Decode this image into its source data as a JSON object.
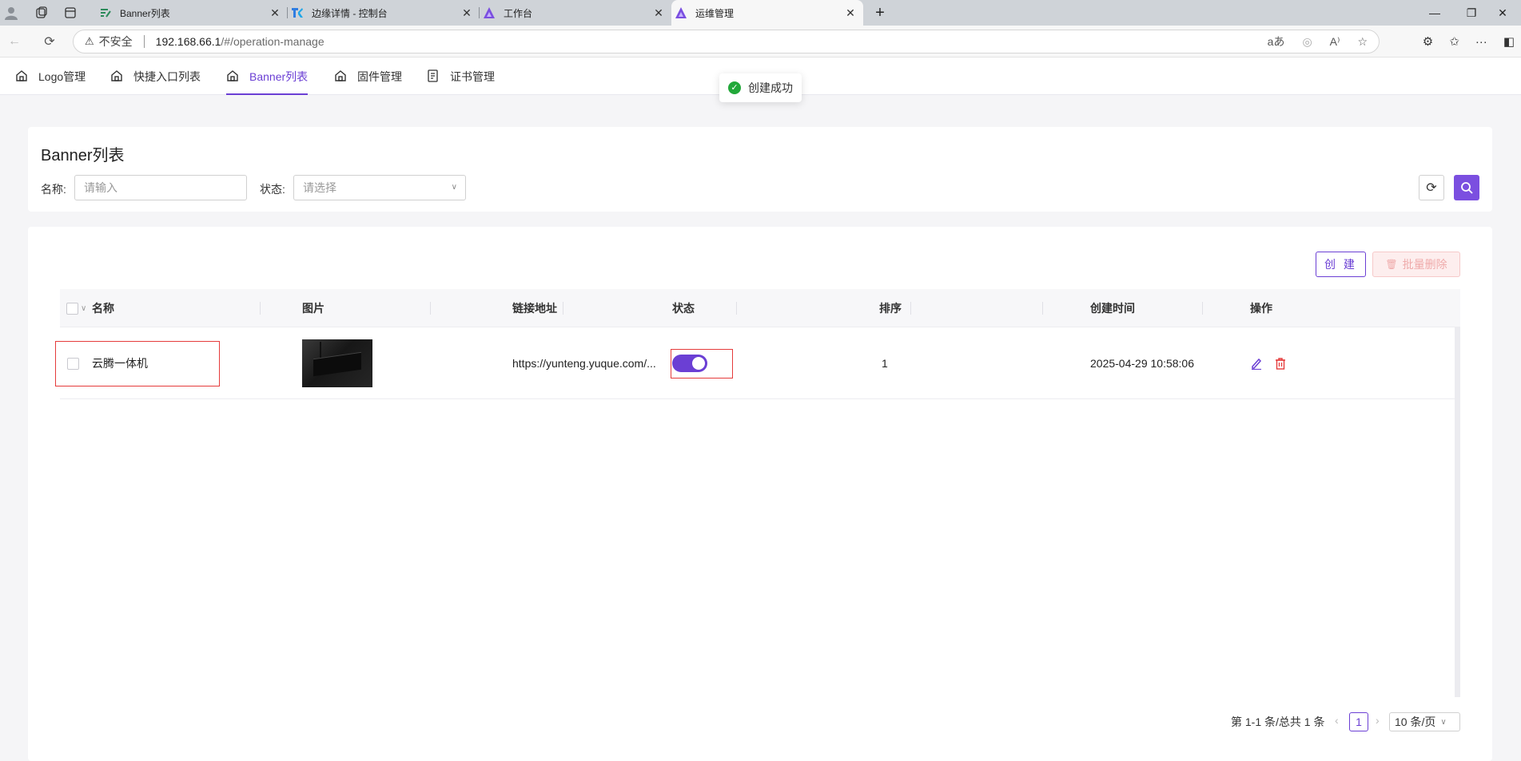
{
  "browser": {
    "tabs": [
      {
        "title": "Banner列表",
        "icon": "edit-list-icon"
      },
      {
        "title": "边缘详情 - 控制台",
        "icon": "tk-logo-icon"
      },
      {
        "title": "工作台",
        "icon": "triangle-logo-icon"
      },
      {
        "title": "运维管理",
        "icon": "triangle-logo-icon",
        "active": true
      }
    ],
    "security_label": "不安全",
    "url_host": "192.168.66.1",
    "url_path": "/#/operation-manage"
  },
  "nav": {
    "tabs": [
      {
        "label": "Logo管理",
        "icon": "home-icon"
      },
      {
        "label": "快捷入口列表",
        "icon": "home-icon"
      },
      {
        "label": "Banner列表",
        "icon": "home-icon",
        "active": true
      },
      {
        "label": "固件管理",
        "icon": "home-icon"
      },
      {
        "label": "证书管理",
        "icon": "certificate-icon"
      }
    ]
  },
  "toast": {
    "message": "创建成功",
    "type": "success"
  },
  "page": {
    "title": "Banner列表"
  },
  "filters": {
    "name_label": "名称:",
    "name_placeholder": "请输入",
    "status_label": "状态:",
    "status_placeholder": "请选择"
  },
  "actions": {
    "create_label": "创 建",
    "batch_delete_label": "批量删除"
  },
  "table": {
    "columns": [
      "名称",
      "图片",
      "链接地址",
      "状态",
      "排序",
      "创建时间",
      "操作"
    ],
    "rows": [
      {
        "name": "云腾一体机",
        "image": "device-photo",
        "link": "https://yunteng.yuque.com/...",
        "status_on": true,
        "sort": "1",
        "created_at": "2025-04-29 10:58:06"
      }
    ]
  },
  "pagination": {
    "summary": "第 1-1 条/总共 1 条",
    "current_page": "1",
    "page_size": "10 条/页"
  },
  "colors": {
    "accent": "#6b3fd4",
    "danger": "#e53b3b",
    "success": "#22a83a"
  }
}
